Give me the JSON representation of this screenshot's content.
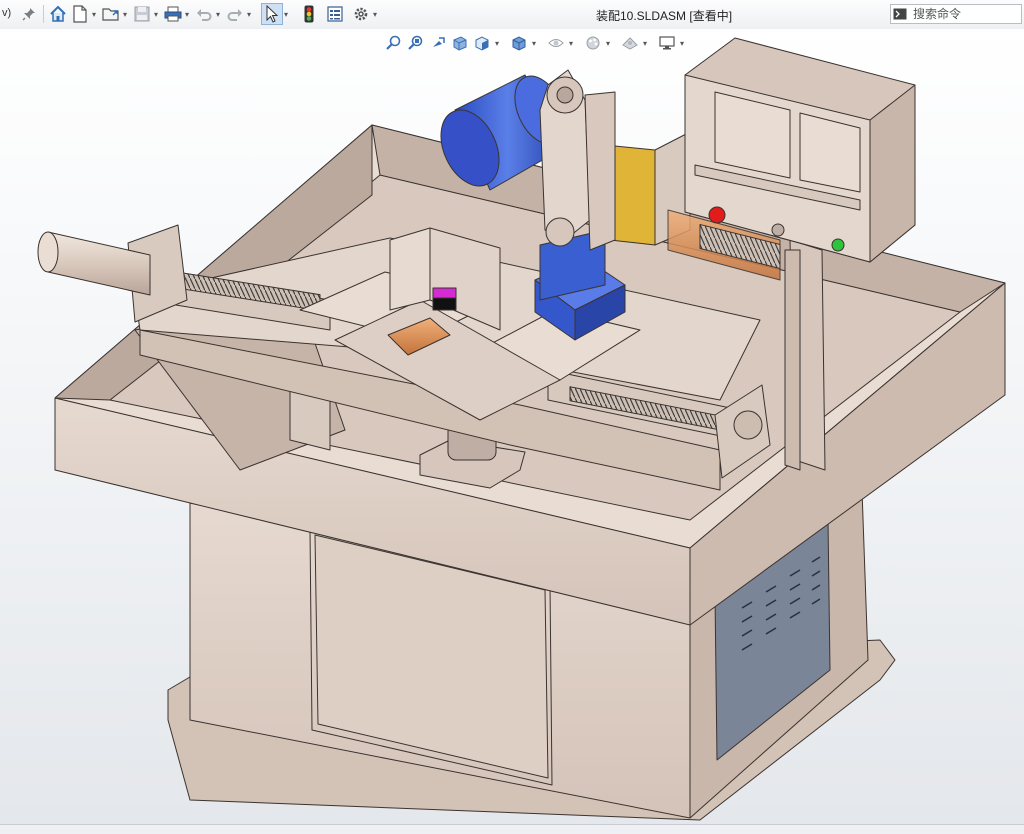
{
  "window": {
    "title": "装配10.SLDASM [查看中]",
    "menu_fragment": "v)"
  },
  "search": {
    "placeholder": "搜索命令"
  },
  "toolbar": {
    "icons": [
      "pin-icon",
      "home-icon",
      "new-document-icon",
      "open-folder-icon",
      "save-icon",
      "print-icon",
      "undo-icon",
      "redo-icon",
      "select-arrow-icon",
      "rebuild-traffic-light-icon",
      "file-properties-icon",
      "options-gear-icon"
    ]
  },
  "heads_up": {
    "icons": [
      "zoom-to-fit-icon",
      "zoom-to-area-icon",
      "previous-view-icon",
      "section-view-icon",
      "view-orientation-icon",
      "display-style-icon",
      "hide-show-items-icon",
      "edit-appearance-icon",
      "apply-scene-icon",
      "view-settings-icon"
    ]
  },
  "colors": {
    "machine_body": "#dccdc3",
    "machine_shadow": "#b8a69b",
    "motor_blue": "#3a5fd0",
    "amber_guard": "#e0b437",
    "copper_part": "#d98c55",
    "magenta_mark": "#d42bd4",
    "panel_blue_gray": "#7a8597"
  }
}
